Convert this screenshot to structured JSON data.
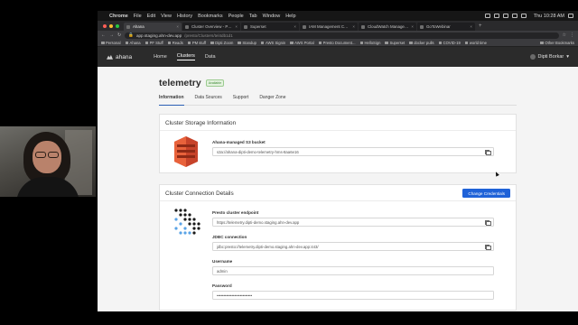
{
  "menubar": {
    "app": "Chrome",
    "menus": [
      "File",
      "Edit",
      "View",
      "History",
      "Bookmarks",
      "People",
      "Tab",
      "Window",
      "Help"
    ],
    "clock": "Thu 10:28 AM"
  },
  "tabs": [
    {
      "label": "Ahana",
      "active": true
    },
    {
      "label": "Cluster Overview - Presto",
      "active": false
    },
    {
      "label": "Superset",
      "active": false
    },
    {
      "label": "IAM Management Console",
      "active": false
    },
    {
      "label": "CloudWatch Management Cons",
      "active": false
    },
    {
      "label": "GoToWebinar",
      "active": false
    }
  ],
  "toolbar": {
    "url_host": "app.staging.ahn-dev.app",
    "url_path": "/presto/Clusters/tel4db1d1"
  },
  "bookmarks": [
    "Personal",
    "Ahana",
    "PF Stuff",
    "Reads",
    "PM stuff",
    "Dipti Zoom",
    "Standup",
    "AWS Signin",
    "AWS Portal",
    "Presto Document...",
    "HelloSign",
    "Superset",
    "docker pulls",
    "COVID-19",
    "world time"
  ],
  "bookmarks_other": "Other Bookmarks",
  "app": {
    "logo_text": "ahana",
    "nav": [
      "Home",
      "Clusters",
      "Data"
    ],
    "user": "Dipti Borkar"
  },
  "cluster": {
    "name": "telemetry",
    "status": "Available",
    "tabs": [
      "Information",
      "Data Sources",
      "Support",
      "Danger Zone"
    ]
  },
  "storage": {
    "title": "Cluster Storage Information",
    "bucket_label": "Ahana-managed S3 bucket",
    "bucket_value": "s3a://ahana-dipti-demo-telemetry-hms-8aa6e16"
  },
  "connection": {
    "title": "Cluster Connection Details",
    "change_button": "Change Credentials",
    "endpoint_label": "Presto cluster endpoint",
    "endpoint_value": "https://telemetry.dipti-demo.staging.ahn-dev.app",
    "jdbc_label": "JDBC connection",
    "jdbc_value": "jdbc:presto://telemetry.dipti-demo.staging.ahn-dev.app:443/",
    "username_label": "Username",
    "username_value": "admin",
    "password_label": "Password",
    "password_value": "••••••••••••••••••••••••••"
  },
  "colors": {
    "primary": "#1f62d8",
    "nav_bg": "#2b2b2b",
    "status_green": "#3f8a37",
    "s3_orange": "#e05a2b"
  }
}
